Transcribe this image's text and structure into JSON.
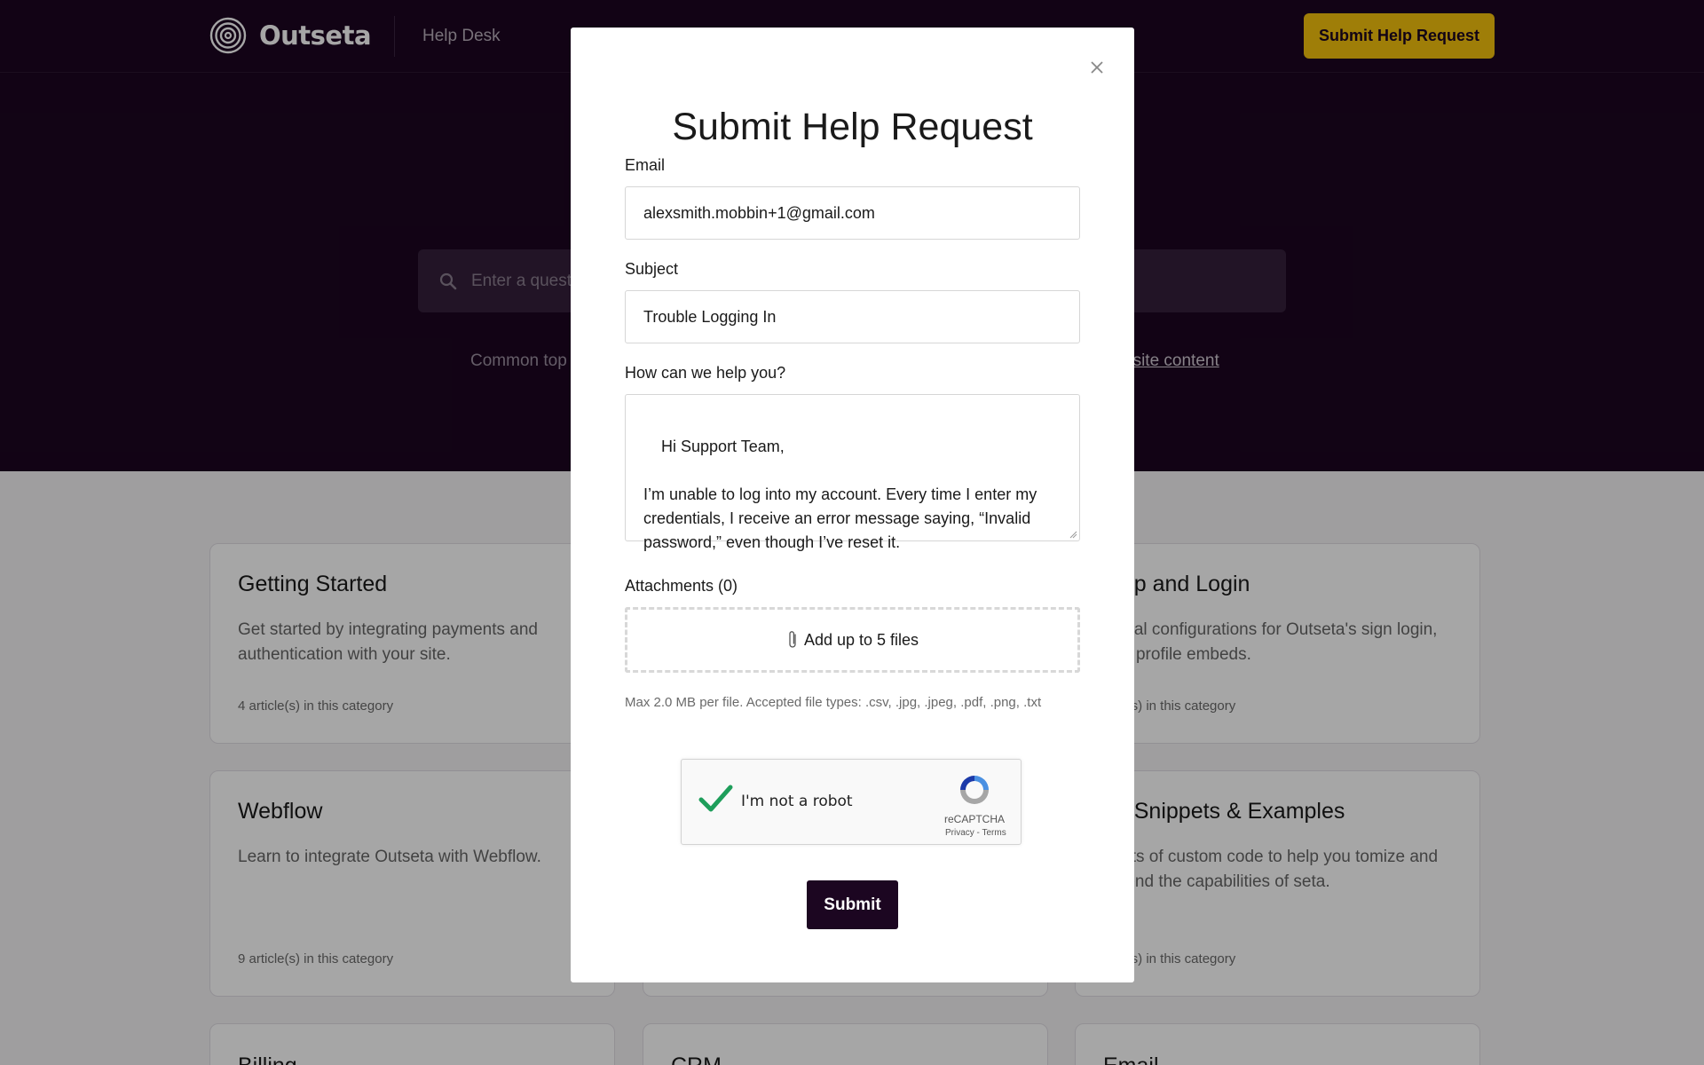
{
  "brand": {
    "name": "Outseta",
    "accent": "#f4c20d",
    "dark": "#1c0621"
  },
  "nav": {
    "help_desk": "Help Desk",
    "submit_request": "Submit Help Request"
  },
  "search": {
    "placeholder": "Enter a quest"
  },
  "topics": {
    "common_label": "Common top",
    "website_link": "osite content"
  },
  "cards": [
    {
      "title": "Getting Started",
      "desc": "Get started by integrating payments and authentication with your site.",
      "count": "4 article(s) in this category"
    },
    {
      "title": "n up and Login",
      "desc": "itional configurations for Outseta's sign login, and profile embeds.",
      "count": "ticle(s) in this category"
    },
    {
      "title": "Webflow",
      "desc": "Learn to integrate Outseta with Webflow.",
      "count": "9 article(s) in this category"
    },
    {
      "title": "de Snippets & Examples",
      "desc": "ppets of custom code to help you tomize and extend the capabilities of seta.",
      "count": "ticle(s) in this category"
    },
    {
      "title": "Billing"
    },
    {
      "title": "CRM"
    },
    {
      "title": "Email"
    }
  ],
  "modal": {
    "title": "Submit Help Request",
    "email_label": "Email",
    "email_value": "alexsmith.mobbin+1@gmail.com",
    "subject_label": "Subject",
    "subject_value": "Trouble Logging In",
    "message_label": "How can we help you?",
    "message_value": "Hi Support Team,\n\nI’m unable to log into my account. Every time I enter my credentials, I receive an error message saying, “Invalid password,” even though I’ve reset it.",
    "attachments_label": "Attachments (0)",
    "dropzone_text": "Add up to 5 files",
    "hint": "Max 2.0 MB per file. Accepted file types: .csv, .jpg, .jpeg, .pdf, .png, .txt",
    "captcha_label": "I'm not a robot",
    "captcha_brand": "reCAPTCHA",
    "captcha_links": "Privacy - Terms",
    "submit_label": "Submit"
  }
}
